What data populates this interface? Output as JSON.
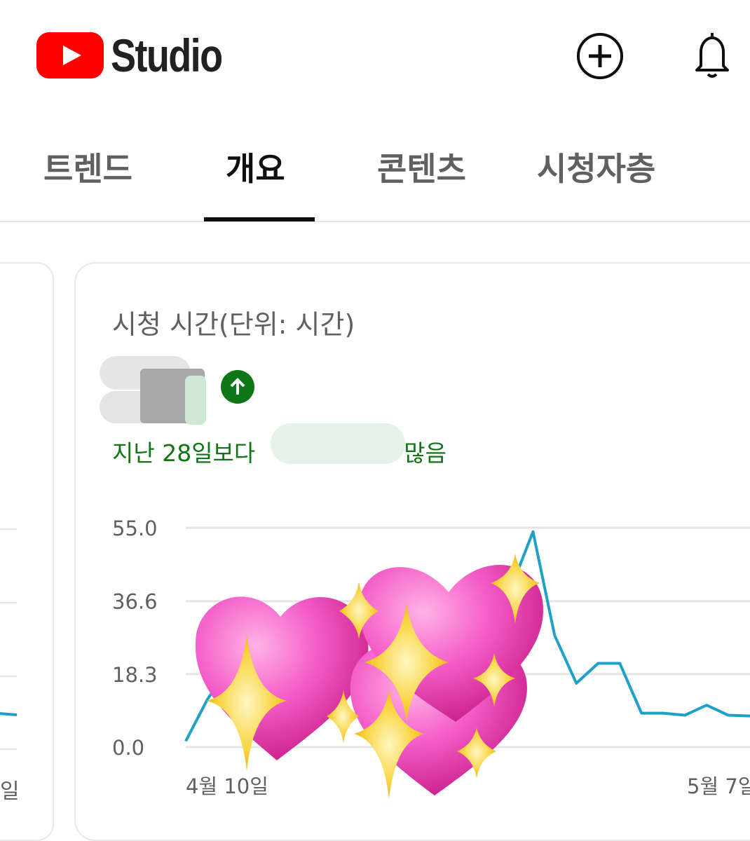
{
  "header": {
    "logo_text": "Studio",
    "icons": {
      "create": "add-circle-icon",
      "notifications": "bell-icon"
    }
  },
  "tabs": [
    {
      "label": "트렌드",
      "active": false
    },
    {
      "label": "개요",
      "active": true
    },
    {
      "label": "콘텐츠",
      "active": false
    },
    {
      "label": "시청자층",
      "active": false
    }
  ],
  "left_card": {
    "x_tick": "일"
  },
  "metric": {
    "title": "시청 시간(단위: 시간)",
    "trend_icon": "arrow-up-icon",
    "comparison_prefix": "지난 28일보다",
    "comparison_suffix": "많음"
  },
  "colors": {
    "brand_red": "#ff0000",
    "positive_green": "#107516",
    "line": "#1ea0c8",
    "grid": "#e5e5e5"
  },
  "chart_data": {
    "type": "line",
    "y_ticks": [
      "55.0",
      "36.6",
      "18.3",
      "0.0"
    ],
    "ylim": [
      0,
      55
    ],
    "x_tick_labels": [
      "4월 10일",
      "5월 7일"
    ],
    "grid": true,
    "series": [
      {
        "values": [
          1.5,
          12,
          20,
          22,
          18,
          24,
          28,
          30,
          35,
          33,
          30,
          26,
          22,
          16,
          30,
          40,
          54,
          28,
          16,
          21,
          21,
          8.5,
          8.5,
          8,
          10.5,
          8,
          7.8
        ]
      }
    ]
  }
}
